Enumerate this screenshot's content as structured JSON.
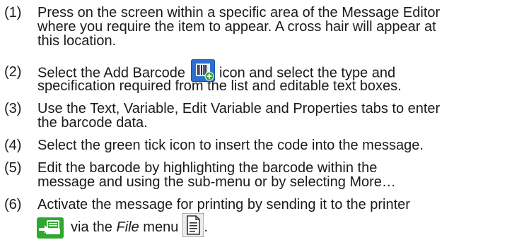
{
  "steps": [
    {
      "num": "(1)",
      "lines": [
        "Press on the screen within a specific area of the Message Editor",
        "where you require the item to appear. A cross hair will appear at",
        "this location."
      ]
    },
    {
      "num": "(2)",
      "line1_pre": "Select the Add Barcode",
      "line1_post": "icon and select the type and",
      "line2": "specification required from the list and editable text boxes.",
      "icon": "add-barcode-icon"
    },
    {
      "num": "(3)",
      "lines": [
        "Use the Text, Variable, Edit Variable and Properties tabs to enter",
        "the barcode data."
      ]
    },
    {
      "num": "(4)",
      "lines": [
        "Select the green tick icon to insert the code into the message."
      ]
    },
    {
      "num": "(5)",
      "lines": [
        "Edit the barcode by highlighting the barcode within the",
        "message and using the sub-menu or by selecting More…"
      ]
    },
    {
      "num": "(6)",
      "line1": "Activate the message for printing by sending it to the printer",
      "line2_pre": "via the",
      "line2_em": "File",
      "line2_post": "menu",
      "line2_end": ".",
      "icons": [
        "send-to-printer-icon",
        "file-menu-icon"
      ]
    }
  ],
  "colors": {
    "text": "#1a1a1a",
    "barcode_icon_bg": "#2c6fcf",
    "green": "#2fa82f"
  }
}
